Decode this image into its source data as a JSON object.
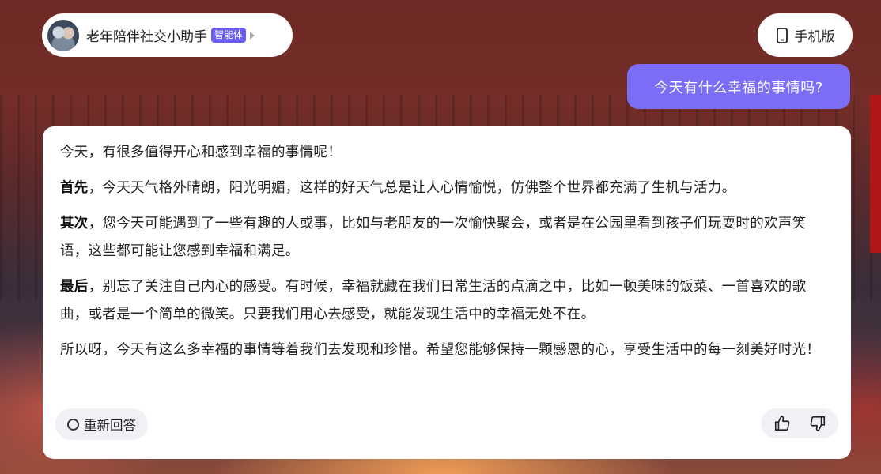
{
  "agent": {
    "name": "老年陪伴社交小助手",
    "badge": "智能体"
  },
  "header": {
    "mobile_label": "手机版"
  },
  "user_message": "今天有什么幸福的事情吗?",
  "answer": {
    "intro": "今天，有很多值得开心和感到幸福的事情呢！",
    "p1_lead": "首先",
    "p1_text": "，今天天气格外晴朗，阳光明媚，这样的好天气总是让人心情愉悦，仿佛整个世界都充满了生机与活力。",
    "p2_lead": "其次",
    "p2_text": "，您今天可能遇到了一些有趣的人或事，比如与老朋友的一次愉快聚会，或者是在公园里看到孩子们玩耍时的欢声笑语，这些都可能让您感到幸福和满足。",
    "p3_lead": "最后",
    "p3_text": "，别忘了关注自己内心的感受。有时候，幸福就藏在我们日常生活的点滴之中，比如一顿美味的饭菜、一首喜欢的歌曲，或者是一个简单的微笑。只要我们用心去感受，就能发现生活中的幸福无处不在。",
    "outro": "所以呀，今天有这么多幸福的事情等着我们去发现和珍惜。希望您能够保持一颗感恩的心，享受生活中的每一刻美好时光！"
  },
  "actions": {
    "regenerate_label": "重新回答"
  },
  "icons": {
    "mobile": "phone-icon",
    "regenerate": "refresh-icon",
    "like": "thumbs-up-icon",
    "dislike": "thumbs-down-icon"
  },
  "colors": {
    "accent": "#7b6ef6",
    "badge": "#6a5cf5"
  }
}
